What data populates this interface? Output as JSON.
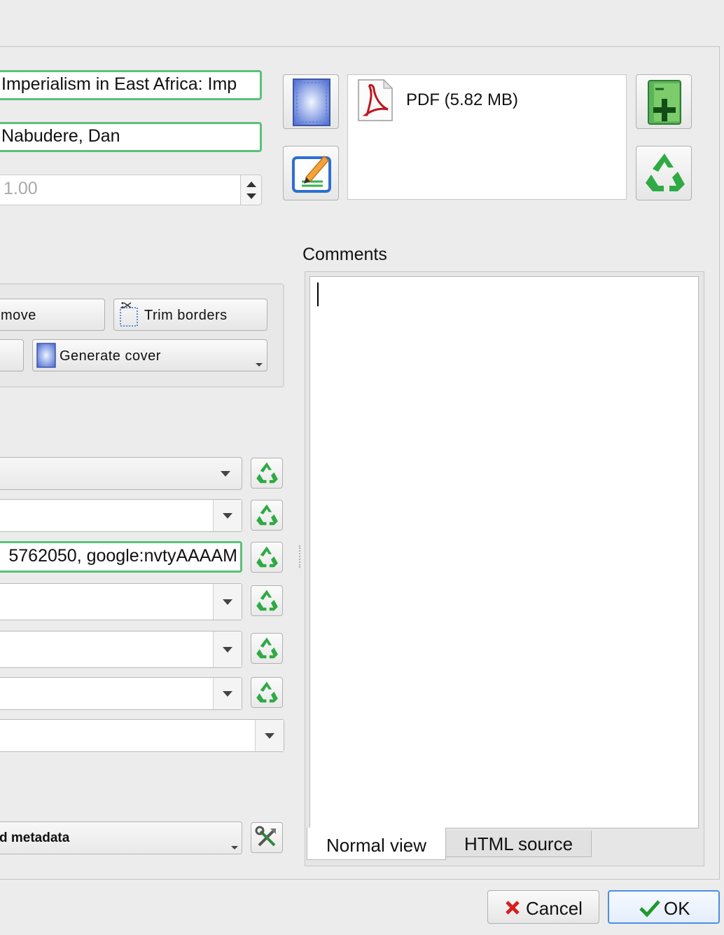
{
  "metadata": {
    "title_value": "Imperialism in East Africa: Imp",
    "author_value": "Nabudere, Dan",
    "series_index_value": "1.00",
    "identifiers_value": "5762050, google:nvtyAAAAM"
  },
  "formats": {
    "items": [
      {
        "label": "PDF (5.82 MB)",
        "icon": "pdf-file-icon"
      }
    ]
  },
  "cover": {
    "remove_label_partial": "move",
    "trim_borders_label": "Trim borders",
    "generate_cover_label": "Generate cover"
  },
  "download": {
    "label_partial": "d metadata"
  },
  "comments": {
    "label": "Comments",
    "tabs": [
      {
        "label": "Normal view",
        "active": true
      },
      {
        "label": "HTML source",
        "active": false
      }
    ]
  },
  "buttons": {
    "cancel": "Cancel",
    "ok": "OK"
  },
  "colors": {
    "focus_green": "#5cc07a",
    "recycle_green": "#2faa44",
    "cancel_red": "#d81e1e",
    "ok_green": "#1f9a2c",
    "ok_border": "#4a90e2"
  }
}
